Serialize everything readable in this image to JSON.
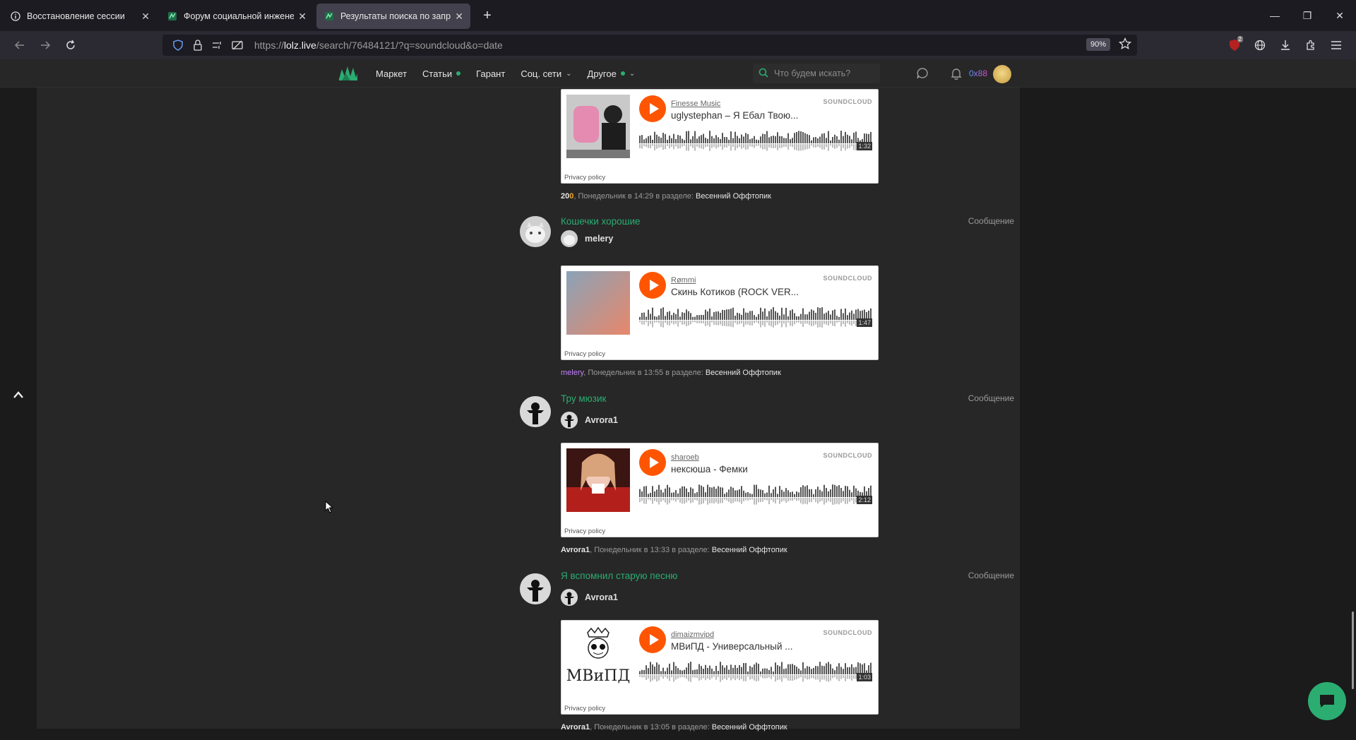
{
  "browser": {
    "tabs": [
      {
        "title": "Восстановление сессии",
        "icon": "info-icon",
        "active": false
      },
      {
        "title": "Форум социальной инженери",
        "icon": "lolz-icon",
        "active": false
      },
      {
        "title": "Результаты поиска по запросу",
        "icon": "lolz-icon",
        "active": true
      }
    ],
    "url_prefix": "https://",
    "url_host": "lolz.live",
    "url_path": "/search/76484121/?q=soundcloud&o=date",
    "zoom": "90%",
    "badge_count": "2"
  },
  "site": {
    "menu": [
      {
        "label": "Маркет"
      },
      {
        "label": "Статьи",
        "dot": true
      },
      {
        "label": "Гарант"
      },
      {
        "label": "Соц. сети",
        "chevron": true
      },
      {
        "label": "Другое",
        "dot": true,
        "chevron": true
      }
    ],
    "search_placeholder": "Что будем искать?",
    "balance": "0x88",
    "accent_color": "#2bad72"
  },
  "posts": [
    {
      "sc": {
        "artist": "Finesse Music",
        "track": "uglystephan – Я Ебал Твою...",
        "duration": "1:32",
        "brand": "SOUNDCLOUD",
        "privacy": "Privacy policy"
      },
      "meta": {
        "user_a": "20",
        "user_b": "0",
        "time": ", Понедельник в 14:29 в разделе: ",
        "section": "Весенний Оффтопик"
      }
    },
    {
      "title": "Кошечки хорошие",
      "type": "Сообщение",
      "author": "melery",
      "sc": {
        "artist": "Rømmi",
        "track": "Скинь Котиков (ROCK VER...",
        "duration": "1:47",
        "brand": "SOUNDCLOUD",
        "privacy": "Privacy policy"
      },
      "meta": {
        "user": "melery",
        "time": ", Понедельник в 13:55 в разделе: ",
        "section": "Весенний Оффтопик"
      }
    },
    {
      "title": "Тру мюзик",
      "type": "Сообщение",
      "author": "Avrora1",
      "sc": {
        "artist": "sharoeb",
        "track": "нексюша - Фемки",
        "duration": "2:12",
        "brand": "SOUNDCLOUD",
        "privacy": "Privacy policy"
      },
      "meta": {
        "user": "Avrora1",
        "time": ", Понедельник в 13:33 в разделе: ",
        "section": "Весенний Оффтопик"
      }
    },
    {
      "title": "Я вспомнил старую песню",
      "type": "Сообщение",
      "author": "Avrora1",
      "sc": {
        "artist": "dimaizmvipd",
        "track": "МВиПД - Универсальный ...",
        "duration": "1:03",
        "brand": "SOUNDCLOUD",
        "privacy": "Privacy policy",
        "art_text": "МВиПД"
      },
      "meta": {
        "user": "Avrora1",
        "time": ", Понедельник в 13:05 в разделе: ",
        "section": "Весенний Оффтопик"
      }
    }
  ]
}
